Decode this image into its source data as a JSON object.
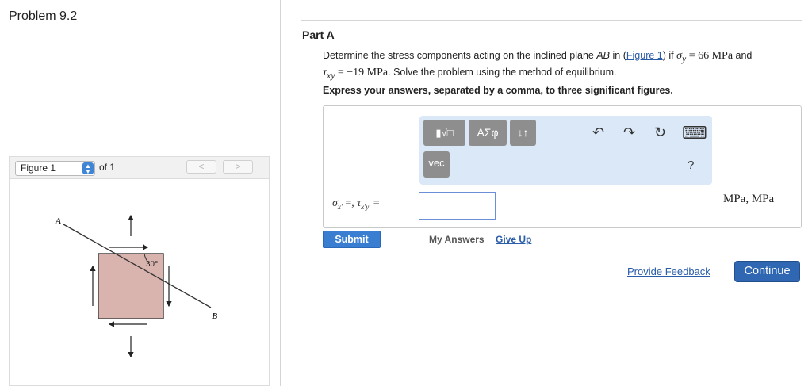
{
  "problem": {
    "title": "Problem 9.2"
  },
  "figure_nav": {
    "selected": "Figure 1",
    "of_label": "of 1",
    "prev_glyph": "<",
    "next_glyph": ">"
  },
  "figure": {
    "label_A": "A",
    "label_B": "B",
    "angle_label": "30°",
    "colors": {
      "block_fill": "#d9b3ae",
      "block_stroke": "#444444"
    }
  },
  "part": {
    "title": "Part A",
    "question_pre": "Determine the stress components acting on the inclined plane ",
    "question_plane": "AB",
    "question_mid": " in (",
    "figure_link": "Figure 1",
    "question_if": ") if ",
    "sigma_y": "σ",
    "sigma_y_sub": "y",
    "sigma_y_value": " = 66 MPa",
    "question_and": " and",
    "tau_xy": "τ",
    "tau_xy_sub": "xy",
    "tau_xy_value": " = −19 MPa",
    "question_end": ". Solve the problem using the method of equilibrium.",
    "instructions": "Express your answers, separated by a comma, to three significant figures."
  },
  "toolbar": {
    "templates_label": "▮√□",
    "greek_label": "ΑΣφ",
    "arrows_label": "↓↑",
    "vec_label": "vec",
    "undo_glyph": "↶",
    "redo_glyph": "↷",
    "reset_glyph": "↻",
    "keyboard_glyph": "⌨",
    "help_label": "?"
  },
  "answer": {
    "sigma_label": "σ",
    "sigma_sub": "x′",
    "sep": " =, ",
    "tau_label": "τ",
    "tau_sub": "x′y′",
    "equals": " =",
    "value": "",
    "units": "MPa, MPa"
  },
  "actions": {
    "submit": "Submit",
    "my_answers": "My Answers",
    "give_up": "Give Up",
    "feedback": "Provide Feedback",
    "continue": "Continue"
  },
  "colors": {
    "accent": "#3a7ed1",
    "link": "#2a5ca8",
    "toolbar_bg": "#dbe8f8"
  }
}
